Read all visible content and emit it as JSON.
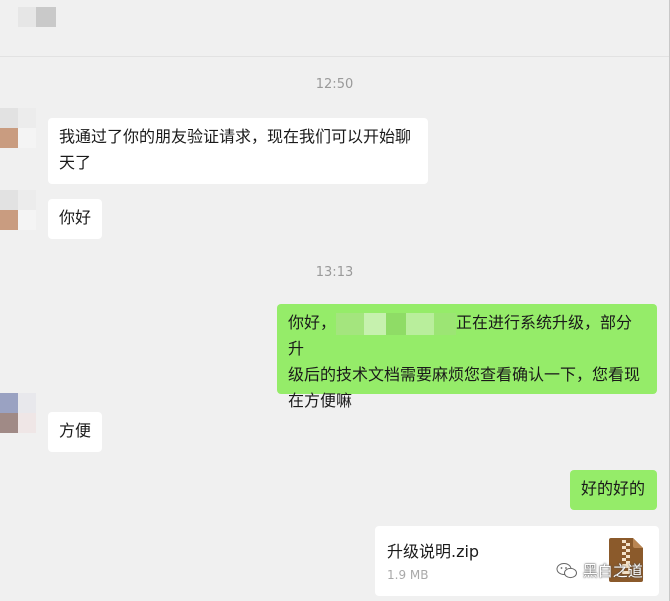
{
  "timestamps": [
    "12:50",
    "13:13"
  ],
  "messages": {
    "m1_line1": "我通过了你的朋友验证请求，现在我们可以开始聊",
    "m1_line2": "天了",
    "m2": "你好",
    "m3_prefix": "你好，",
    "m3_line1_suffix": "正在进行系统升级，部分升",
    "m3_line2": "级后的技术文档需要麻烦您查看确认一下，您看现",
    "m3_line3": "在方便嘛",
    "m4": "方便",
    "m5": "好的好的"
  },
  "file": {
    "name": "升级说明.zip",
    "size": "1.9 MB",
    "icon": "zip-archive-icon"
  },
  "watermark": {
    "text": "黑白之道",
    "icon": "wechat-icon"
  },
  "colors": {
    "background": "#f0f0f0",
    "incoming_bubble": "#ffffff",
    "outgoing_bubble": "#95ec69",
    "timestamp": "#9a9a9a",
    "zip_icon": "#8b5a2b"
  }
}
